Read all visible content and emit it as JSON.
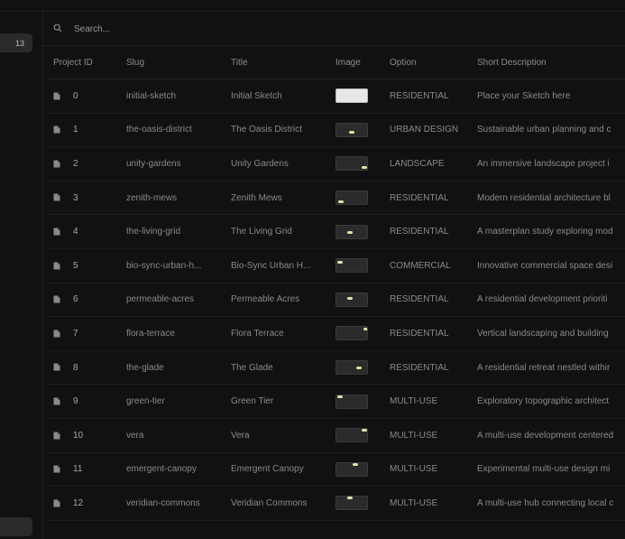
{
  "sidebar": {
    "badge_count": "13"
  },
  "search": {
    "placeholder": "Search..."
  },
  "table": {
    "headers": [
      "Project ID",
      "Slug",
      "Title",
      "Image",
      "Option",
      "Short Description"
    ],
    "rows": [
      {
        "id": "0",
        "slug": "initial-sketch",
        "title": "Initial Sketch",
        "option": "RESIDENTIAL",
        "desc": "Place your Sketch here"
      },
      {
        "id": "1",
        "slug": "the-oasis-district",
        "title": "The Oasis District",
        "option": "URBAN DESIGN",
        "desc": "Sustainable urban planning and c"
      },
      {
        "id": "2",
        "slug": "unity-gardens",
        "title": "Unity Gardens",
        "option": "LANDSCAPE",
        "desc": "An immersive landscape project i"
      },
      {
        "id": "3",
        "slug": "zenith-mews",
        "title": "Zenith Mews",
        "option": "RESIDENTIAL",
        "desc": "Modern residential architecture bl"
      },
      {
        "id": "4",
        "slug": "the-living-grid",
        "title": "The Living Grid",
        "option": "RESIDENTIAL",
        "desc": "A masterplan study exploring mod"
      },
      {
        "id": "5",
        "slug": "bio-sync-urban-h...",
        "title": "Bio-Sync Urban H...",
        "option": "COMMERCIAL",
        "desc": "Innovative commercial space desi"
      },
      {
        "id": "6",
        "slug": "permeable-acres",
        "title": "Permeable Acres",
        "option": "RESIDENTIAL",
        "desc": "A residential development prioriti"
      },
      {
        "id": "7",
        "slug": "flora-terrace",
        "title": "Flora Terrace",
        "option": "RESIDENTIAL",
        "desc": "Vertical landscaping and building"
      },
      {
        "id": "8",
        "slug": "the-glade",
        "title": "The Glade",
        "option": "RESIDENTIAL",
        "desc": "A residential retreat nestled withir"
      },
      {
        "id": "9",
        "slug": "green-tier",
        "title": "Green Tier",
        "option": "MULTI-USE",
        "desc": "Exploratory topographic architect"
      },
      {
        "id": "10",
        "slug": "vera",
        "title": "Vera",
        "option": "MULTI-USE",
        "desc": "A multi-use development centered"
      },
      {
        "id": "11",
        "slug": "emergent-canopy",
        "title": "Emergent Canopy",
        "option": "MULTI-USE",
        "desc": "Experimental multi-use design mi"
      },
      {
        "id": "12",
        "slug": "veridian-commons",
        "title": "Veridian Commons",
        "option": "MULTI-USE",
        "desc": "A multi-use hub connecting local c"
      }
    ]
  }
}
